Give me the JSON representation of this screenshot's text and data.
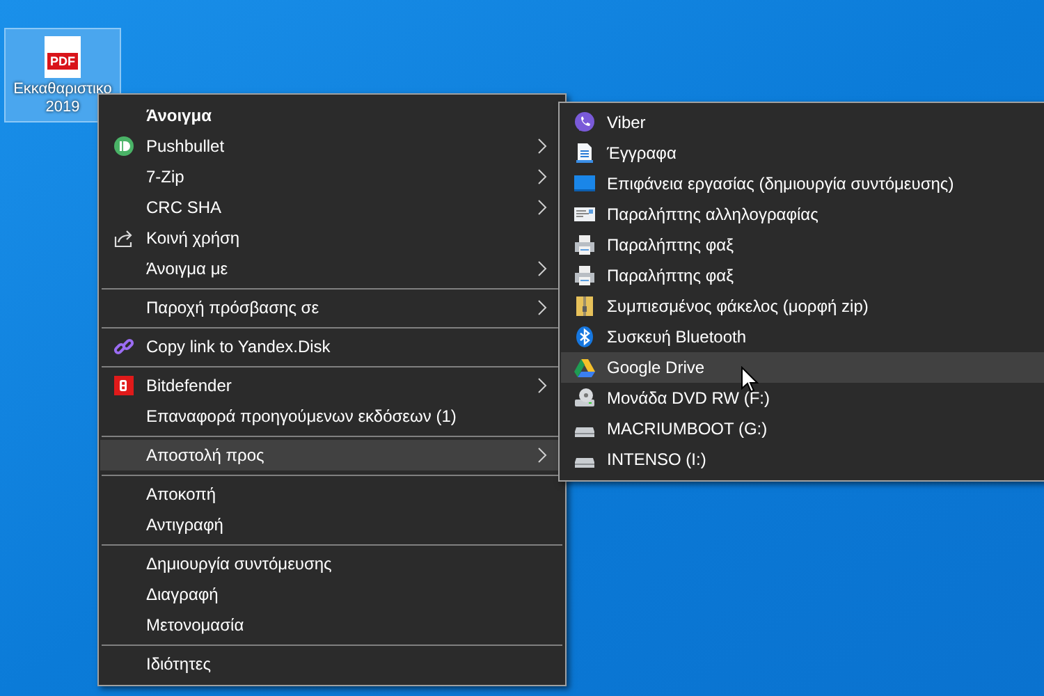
{
  "desktop_icon": {
    "badge": "PDF",
    "label": "Εκκαθαριστικο 2019",
    "selected": true
  },
  "context_menu": {
    "items": [
      {
        "kind": "item",
        "label": "Άνοιγμα",
        "default": true,
        "submenu": false,
        "selected": false
      },
      {
        "kind": "item",
        "label": "Pushbullet",
        "default": false,
        "submenu": true,
        "selected": false
      },
      {
        "kind": "item",
        "label": "7-Zip",
        "default": false,
        "submenu": true,
        "selected": false
      },
      {
        "kind": "item",
        "label": "CRC SHA",
        "default": false,
        "submenu": true,
        "selected": false
      },
      {
        "kind": "item",
        "label": "Κοινή χρήση",
        "default": false,
        "submenu": false,
        "selected": false
      },
      {
        "kind": "item",
        "label": "Άνοιγμα με",
        "default": false,
        "submenu": true,
        "selected": false
      },
      {
        "kind": "separator"
      },
      {
        "kind": "item",
        "label": "Παροχή πρόσβασης σε",
        "default": false,
        "submenu": true,
        "selected": false
      },
      {
        "kind": "separator"
      },
      {
        "kind": "item",
        "label": "Copy link to Yandex.Disk",
        "default": false,
        "submenu": false,
        "selected": false
      },
      {
        "kind": "separator"
      },
      {
        "kind": "item",
        "label": "Bitdefender",
        "default": false,
        "submenu": true,
        "selected": false
      },
      {
        "kind": "item",
        "label": "Επαναφορά προηγούμενων εκδόσεων (1)",
        "default": false,
        "submenu": false,
        "selected": false
      },
      {
        "kind": "separator"
      },
      {
        "kind": "item",
        "label": "Αποστολή προς",
        "default": false,
        "submenu": true,
        "selected": true
      },
      {
        "kind": "separator"
      },
      {
        "kind": "item",
        "label": "Αποκοπή",
        "default": false,
        "submenu": false,
        "selected": false
      },
      {
        "kind": "item",
        "label": "Αντιγραφή",
        "default": false,
        "submenu": false,
        "selected": false
      },
      {
        "kind": "separator"
      },
      {
        "kind": "item",
        "label": "Δημιουργία συντόμευσης",
        "default": false,
        "submenu": false,
        "selected": false
      },
      {
        "kind": "item",
        "label": "Διαγραφή",
        "default": false,
        "submenu": false,
        "selected": false
      },
      {
        "kind": "item",
        "label": "Μετονομασία",
        "default": false,
        "submenu": false,
        "selected": false
      },
      {
        "kind": "separator"
      },
      {
        "kind": "item",
        "label": "Ιδιότητες",
        "default": false,
        "submenu": false,
        "selected": false
      }
    ]
  },
  "send_to_submenu": {
    "items": [
      {
        "label": "Viber",
        "selected": false
      },
      {
        "label": "Έγγραφα",
        "selected": false
      },
      {
        "label": "Επιφάνεια εργασίας (δημιουργία συντόμευσης)",
        "selected": false
      },
      {
        "label": "Παραλήπτης αλληλογραφίας",
        "selected": false
      },
      {
        "label": "Παραλήπτης φαξ",
        "selected": false
      },
      {
        "label": "Παραλήπτης φαξ",
        "selected": false
      },
      {
        "label": "Συμπιεσμένος φάκελος (μορφή zip)",
        "selected": false
      },
      {
        "label": "Συσκευή Bluetooth",
        "selected": false
      },
      {
        "label": "Google Drive",
        "selected": true
      },
      {
        "label": "Μονάδα DVD RW (F:)",
        "selected": false
      },
      {
        "label": "MACRIUMBOOT (G:)",
        "selected": false
      },
      {
        "label": "INTENSO (I:)",
        "selected": false
      }
    ]
  }
}
